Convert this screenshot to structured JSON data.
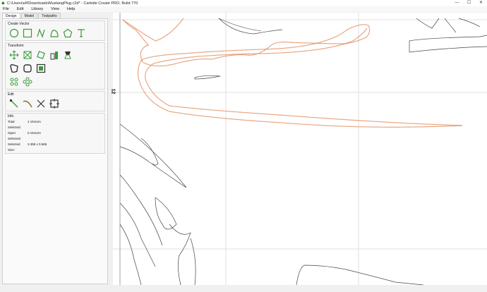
{
  "window": {
    "title": "C:\\Users\\elf\\Downloads\\MustangPlug.c2d* - Carbide Create PRO, Build 770",
    "app_icon": "carbide-icon",
    "minimize": "—",
    "maximize": "☐",
    "close": "✕"
  },
  "menu": {
    "file": "File",
    "edit": "Edit",
    "library": "Library",
    "view": "View",
    "help": "Help"
  },
  "tabs": {
    "design": "Design",
    "model": "Model",
    "toolpaths": "Toolpaths"
  },
  "groups": {
    "create_vector": "Create Vector",
    "transform": "Transform",
    "edit": "Edit",
    "info": "Info"
  },
  "info": {
    "total_selected_label": "Total Selected:",
    "total_selected_value": "1 Vectors",
    "open_selected_label": "Open Selected:",
    "open_selected_value": "0 Vectors",
    "selected_size_label": "Selected Size:",
    "selected_size_value": "2.395 x 0.665"
  },
  "canvas": {
    "ruler_label": "12"
  },
  "colors": {
    "accent_green": "#3a9a3a",
    "selected_vector": "#e0895a",
    "vector": "#444444",
    "grid": "#d8d8d8"
  }
}
